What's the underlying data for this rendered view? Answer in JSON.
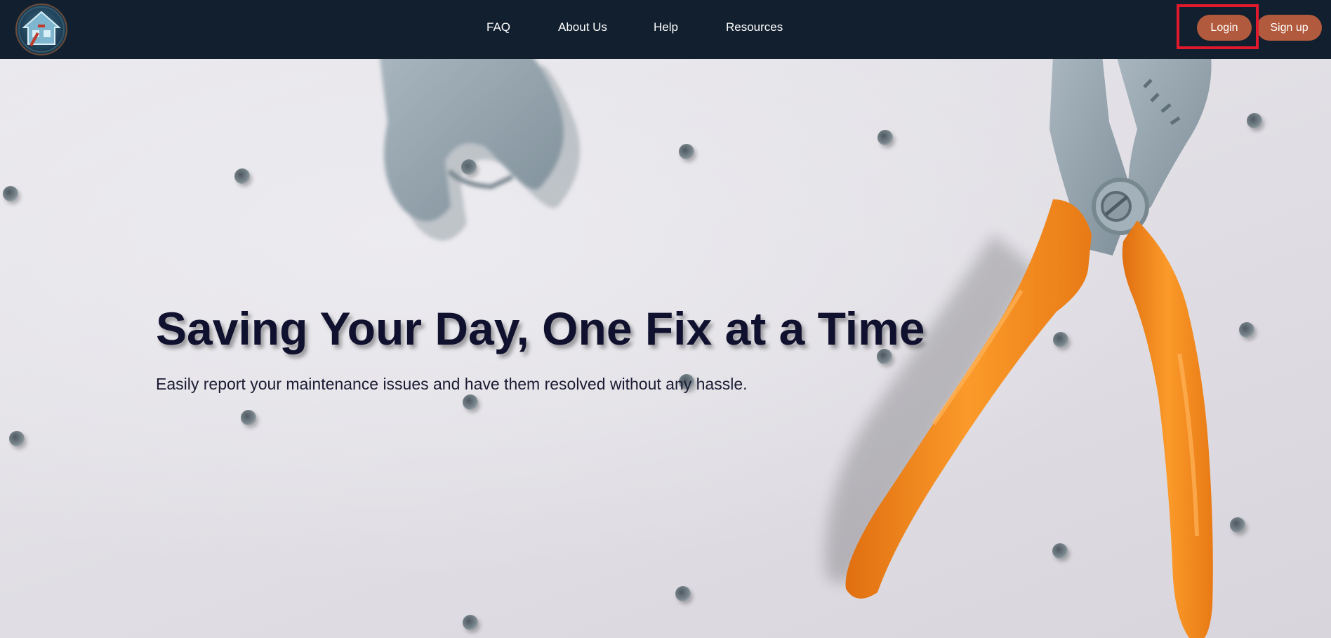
{
  "navbar": {
    "logo_icon": "house-tools-logo-icon",
    "links": [
      {
        "label": "FAQ"
      },
      {
        "label": "About Us"
      },
      {
        "label": "Help"
      },
      {
        "label": "Resources"
      }
    ],
    "login_label": "Login",
    "signup_label": "Sign up"
  },
  "hero": {
    "title": "Saving Your Day, One Fix at a Time",
    "subtitle": "Easily report your maintenance issues and have them resolved without any hassle.",
    "background_image": "wrench-and-orange-pliers-on-pegboard"
  },
  "colors": {
    "navbar_bg": "#111f2e",
    "button_bg": "#b25a3d",
    "button_text": "#ffffff",
    "highlight_border": "#e0192d",
    "title_color": "#10112e",
    "pliers_handle": "#f7901e",
    "tool_gray": "#9aa9b3"
  }
}
